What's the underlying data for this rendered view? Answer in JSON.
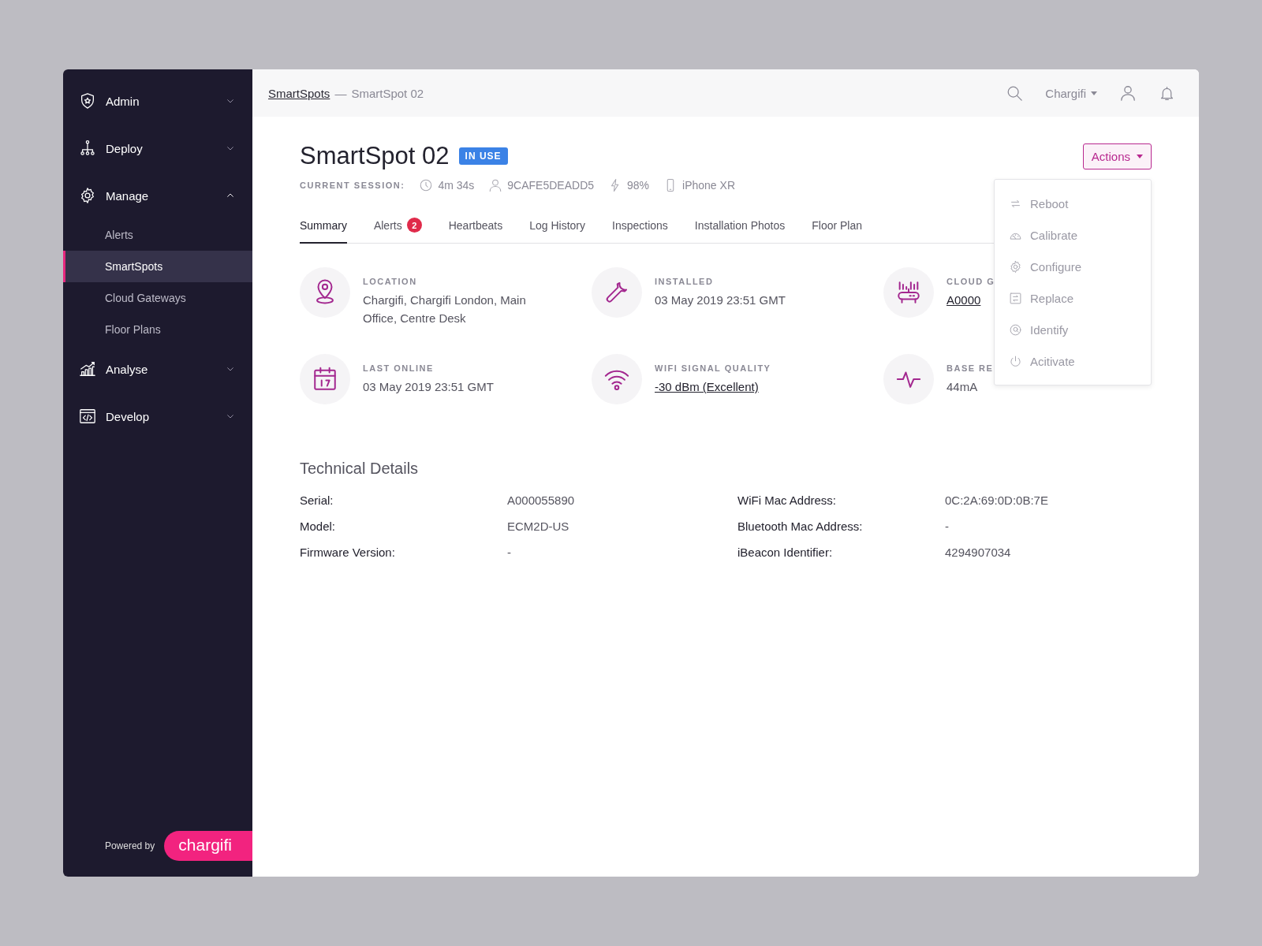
{
  "sidebar": {
    "groups": [
      {
        "label": "Admin",
        "expanded": false
      },
      {
        "label": "Deploy",
        "expanded": false
      },
      {
        "label": "Manage",
        "expanded": true,
        "children": [
          {
            "label": "Alerts",
            "selected": false
          },
          {
            "label": "SmartSpots",
            "selected": true
          },
          {
            "label": "Cloud Gateways",
            "selected": false
          },
          {
            "label": "Floor Plans",
            "selected": false
          }
        ]
      },
      {
        "label": "Analyse",
        "expanded": false
      },
      {
        "label": "Develop",
        "expanded": false
      }
    ],
    "footer": {
      "text": "Powered by",
      "logo": "chargifi"
    }
  },
  "topbar": {
    "breadcrumb": {
      "link": "SmartSpots",
      "separator": "—",
      "current": "SmartSpot 02"
    },
    "account": "Chargifi"
  },
  "header": {
    "title": "SmartSpot 02",
    "status": "IN USE",
    "session_label": "CURRENT SESSION:",
    "session": [
      "4m 34s",
      "9CAFE5DEADD5",
      "98%",
      "iPhone XR"
    ]
  },
  "actions": {
    "label": "Actions",
    "expanded": true,
    "items": [
      "Reboot",
      "Calibrate",
      "Configure",
      "Replace",
      "Identify",
      "Acitivate"
    ]
  },
  "tabs": [
    {
      "label": "Summary",
      "selected": true
    },
    {
      "label": "Alerts",
      "selected": false,
      "badge": "2"
    },
    {
      "label": "Heartbeats",
      "selected": false
    },
    {
      "label": "Log History",
      "selected": false
    },
    {
      "label": "Inspections",
      "selected": false
    },
    {
      "label": "Installation Photos",
      "selected": false
    },
    {
      "label": "Floor Plan",
      "selected": false
    }
  ],
  "info": [
    {
      "label": "LOCATION",
      "value": "Chargifi, Chargifi London, Main Office, Centre Desk",
      "link": false
    },
    {
      "label": "INSTALLED",
      "value": "03 May 2019 23:51 GMT",
      "link": false
    },
    {
      "label": "CLOUD G",
      "value": "A0000",
      "link": true
    },
    {
      "label": "LAST ONLINE",
      "value": "03 May 2019 23:51 GMT",
      "link": false
    },
    {
      "label": "WIFI SIGNAL QUALITY",
      "value": "-30 dBm (Excellent)",
      "link": true
    },
    {
      "label": "BASE RE",
      "value": "44mA",
      "link": false
    }
  ],
  "technical_details": {
    "title": "Technical Details",
    "rows": [
      {
        "label": "Serial:",
        "value": "A000055890"
      },
      {
        "label": "WiFi Mac Address:",
        "value": "0C:2A:69:0D:0B:7E"
      },
      {
        "label": "Model:",
        "value": "ECM2D-US"
      },
      {
        "label": "Bluetooth Mac Address:",
        "value": "-"
      },
      {
        "label": "Firmware Version:",
        "value": "-"
      },
      {
        "label": "iBeacon Identifier:",
        "value": "4294907034"
      }
    ]
  }
}
